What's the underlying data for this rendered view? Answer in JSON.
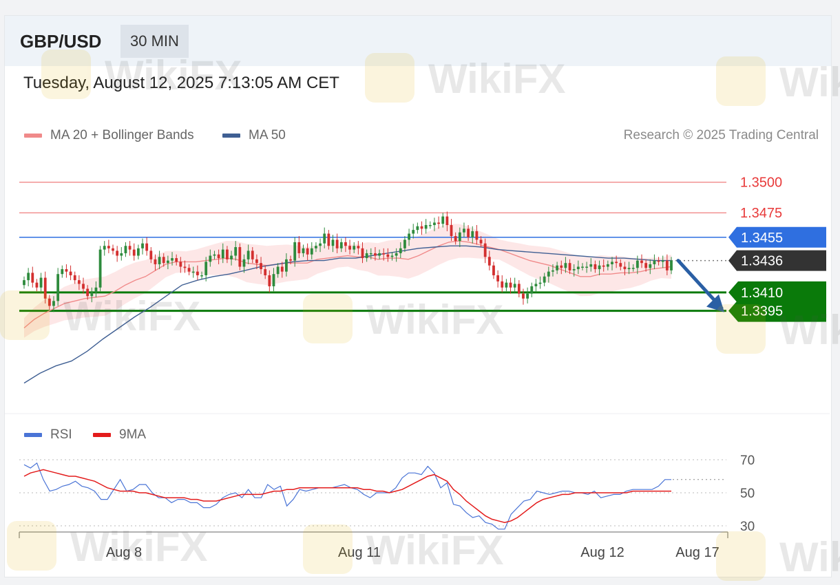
{
  "header": {
    "symbol": "GBP/USD",
    "timeframe": "30 MIN",
    "datetime": "Tuesday, August 12, 2025 7:13:05 AM CET"
  },
  "legend": {
    "ma20_label": "MA 20 + Bollinger Bands",
    "ma50_label": "MA 50",
    "copyright": "Research © 2025 Trading Central"
  },
  "rsi_legend": {
    "rsi_label": "RSI",
    "ma_label": "9MA"
  },
  "colors": {
    "up": "#2e8b3d",
    "down": "#d32f2f",
    "ma20": "#f08a8a",
    "band": "#fde3e3",
    "ma50": "#3f5f93",
    "resistance": "#e83a3a",
    "pivot": "#2f6fe0",
    "support": "#0a7a0a",
    "last": "#333333",
    "arrow": "#2a5fa4",
    "rsi": "#4a74d6",
    "rsi_ma": "#e31b1b"
  },
  "watermark": "WikiFX",
  "chart_data": [
    {
      "type": "candlestick",
      "title": "GBP/USD",
      "y_range": [
        1.3315,
        1.3515
      ],
      "x_ticks": [
        "Aug 8",
        "Aug 11",
        "Aug 12",
        "Aug 17"
      ],
      "levels": [
        {
          "label": "1.3500",
          "value": 1.35,
          "kind": "resistance"
        },
        {
          "label": "1.3475",
          "value": 1.3475,
          "kind": "resistance"
        },
        {
          "label": "1.3455",
          "value": 1.3455,
          "kind": "pivot"
        },
        {
          "label": "1.3436",
          "value": 1.3436,
          "kind": "last"
        },
        {
          "label": "1.3410",
          "value": 1.341,
          "kind": "support"
        },
        {
          "label": "1.3395",
          "value": 1.3395,
          "kind": "support"
        }
      ],
      "forecast": {
        "from": 1.3436,
        "to": 1.3395,
        "direction": "down"
      },
      "close": [
        1.342,
        1.3426,
        1.3418,
        1.3414,
        1.3422,
        1.3405,
        1.3399,
        1.3403,
        1.3425,
        1.3429,
        1.3427,
        1.3424,
        1.342,
        1.3417,
        1.3413,
        1.3407,
        1.341,
        1.3414,
        1.3445,
        1.3448,
        1.3446,
        1.3444,
        1.344,
        1.3442,
        1.3448,
        1.3445,
        1.344,
        1.3446,
        1.345,
        1.3444,
        1.3437,
        1.3433,
        1.3439,
        1.3434,
        1.3436,
        1.3438,
        1.3435,
        1.3431,
        1.343,
        1.3427,
        1.3427,
        1.3424,
        1.3424,
        1.3435,
        1.344,
        1.3441,
        1.3438,
        1.3445,
        1.3437,
        1.344,
        1.3447,
        1.3431,
        1.3437,
        1.3444,
        1.3437,
        1.3434,
        1.3429,
        1.3424,
        1.3415,
        1.3425,
        1.3431,
        1.3427,
        1.3437,
        1.3436,
        1.3451,
        1.3442,
        1.3446,
        1.3441,
        1.3446,
        1.3448,
        1.345,
        1.3458,
        1.3448,
        1.3453,
        1.3446,
        1.3451,
        1.3448,
        1.3445,
        1.3448,
        1.3446,
        1.3438,
        1.3442,
        1.3442,
        1.344,
        1.3442,
        1.3441,
        1.3439,
        1.344,
        1.3442,
        1.3446,
        1.3453,
        1.3458,
        1.3461,
        1.3464,
        1.3462,
        1.3465,
        1.3465,
        1.3467,
        1.3466,
        1.3472,
        1.3465,
        1.3456,
        1.3452,
        1.3459,
        1.3462,
        1.3455,
        1.346,
        1.3453,
        1.345,
        1.3439,
        1.3432,
        1.3424,
        1.3419,
        1.3414,
        1.3418,
        1.3414,
        1.3417,
        1.3409,
        1.3405,
        1.3409,
        1.3415,
        1.3417,
        1.3418,
        1.3423,
        1.3427,
        1.3428,
        1.3432,
        1.343,
        1.3434,
        1.3428,
        1.3429,
        1.3431,
        1.3431,
        1.3431,
        1.3433,
        1.3429,
        1.3432,
        1.3431,
        1.3433,
        1.3435,
        1.3434,
        1.3431,
        1.3429,
        1.343,
        1.343,
        1.3436,
        1.3434,
        1.343,
        1.3433,
        1.3436,
        1.3435,
        1.3436,
        1.3428,
        1.3436
      ],
      "ma20": [
        1.3381,
        1.3388,
        1.3393,
        1.3397,
        1.3401,
        1.3403,
        1.3405,
        1.3406,
        1.3407,
        1.3411,
        1.3416,
        1.342,
        1.3423,
        1.3428,
        1.3433,
        1.3435,
        1.3435,
        1.3435,
        1.3436,
        1.3437,
        1.3438,
        1.3437,
        1.3434,
        1.3433,
        1.3432,
        1.3433,
        1.3434,
        1.3434,
        1.3434,
        1.3437,
        1.3438,
        1.3439,
        1.344,
        1.3439,
        1.3439,
        1.3437,
        1.3438,
        1.3438,
        1.3437,
        1.344,
        1.3444,
        1.3448,
        1.3451,
        1.3452,
        1.3451,
        1.3449,
        1.3447,
        1.3445,
        1.3442,
        1.3439,
        1.3436,
        1.3434,
        1.3432,
        1.3429,
        1.3426,
        1.3423,
        1.3423,
        1.3425,
        1.3425,
        1.3426,
        1.3426,
        1.3427,
        1.3429,
        1.343,
        1.3431
      ],
      "ma50": [
        1.3336,
        1.3344,
        1.335,
        1.3354,
        1.3362,
        1.3372,
        1.3381,
        1.339,
        1.3398,
        1.3407,
        1.3416,
        1.342,
        1.3423,
        1.3425,
        1.3428,
        1.3431,
        1.3433,
        1.3435,
        1.3436,
        1.3436,
        1.3438,
        1.3438,
        1.344,
        1.3442,
        1.3444,
        1.3446,
        1.3447,
        1.3448,
        1.3448,
        1.3447,
        1.3445,
        1.3444,
        1.3443,
        1.3442,
        1.3441,
        1.344,
        1.3439,
        1.3438,
        1.3438,
        1.3437,
        1.3436,
        1.3436
      ]
    },
    {
      "type": "line",
      "title": "RSI",
      "y_range": [
        20,
        80
      ],
      "y_ticks": [
        70,
        50,
        30
      ],
      "series": [
        {
          "name": "RSI",
          "values": [
            67,
            65,
            68,
            58,
            51,
            52,
            54,
            55,
            57,
            54,
            53,
            51,
            46,
            46,
            52,
            58,
            51,
            52,
            55,
            55,
            50,
            47,
            47,
            44,
            46,
            46,
            44,
            44,
            41,
            41,
            43,
            47,
            49,
            50,
            47,
            52,
            47,
            47,
            55,
            52,
            54,
            42,
            46,
            52,
            51,
            52,
            53,
            53,
            53,
            54,
            55,
            53,
            52,
            49,
            47,
            50,
            50,
            50,
            53,
            59,
            62,
            62,
            61,
            66,
            62,
            53,
            56,
            43,
            42,
            38,
            35,
            36,
            32,
            31,
            28,
            28,
            37,
            41,
            45,
            46,
            51,
            50,
            49,
            50,
            51,
            51,
            50,
            50,
            49,
            51,
            47,
            48,
            49,
            49,
            51,
            52,
            52,
            52,
            52,
            54,
            58,
            58
          ]
        },
        {
          "name": "9MA",
          "values": [
            60,
            62,
            63,
            64,
            63,
            62,
            61,
            60,
            60,
            59,
            58,
            57,
            55,
            53,
            52,
            51,
            51,
            51,
            50,
            50,
            49,
            48,
            47,
            47,
            47,
            47,
            46,
            46,
            45,
            45,
            45,
            46,
            47,
            48,
            49,
            49,
            49,
            49,
            50,
            51,
            51,
            52,
            52,
            53,
            53,
            53,
            53,
            53,
            53,
            53,
            53,
            53,
            53,
            52,
            52,
            51,
            51,
            50,
            51,
            52,
            54,
            56,
            58,
            60,
            61,
            59,
            57,
            52,
            49,
            45,
            42,
            39,
            36,
            34,
            33,
            32,
            33,
            35,
            38,
            41,
            44,
            46,
            47,
            48,
            49,
            49,
            50,
            50,
            50,
            50,
            50,
            50,
            50,
            50,
            50,
            51,
            51,
            51,
            51,
            51,
            51,
            51
          ]
        }
      ]
    }
  ]
}
